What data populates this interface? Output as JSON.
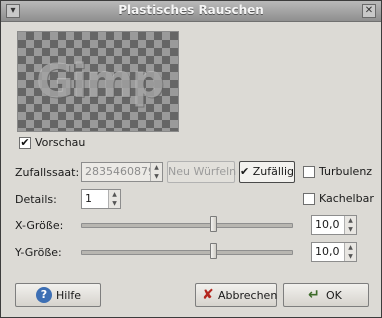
{
  "window": {
    "title": "Plastisches Rauschen",
    "menu_glyph": "▾",
    "close_glyph": "✕"
  },
  "preview": {
    "label": "Vorschau",
    "checked": true,
    "watermark_text": "Gimp"
  },
  "seed": {
    "label": "Zufallssaat:",
    "value": "2835460879",
    "new_seed_button": "Neu Würfeln",
    "random_label": "Zufällig",
    "random_checked": true
  },
  "turbulence": {
    "label": "Turbulenz",
    "checked": false
  },
  "details": {
    "label": "Details:",
    "value": "1"
  },
  "tileable": {
    "label": "Kachelbar",
    "checked": false
  },
  "x_size": {
    "label": "X-Größe:",
    "value": "10,0",
    "level": 0.63
  },
  "y_size": {
    "label": "Y-Größe:",
    "value": "10,0",
    "level": 0.63
  },
  "buttons": {
    "help": "Hilfe",
    "cancel": "Abbrechen",
    "ok": "OK"
  },
  "glyphs": {
    "check": "✔",
    "spin_up": "▲",
    "spin_down": "▼",
    "help_icon": "?",
    "cancel_icon": "✘",
    "ok_icon": "↵"
  }
}
